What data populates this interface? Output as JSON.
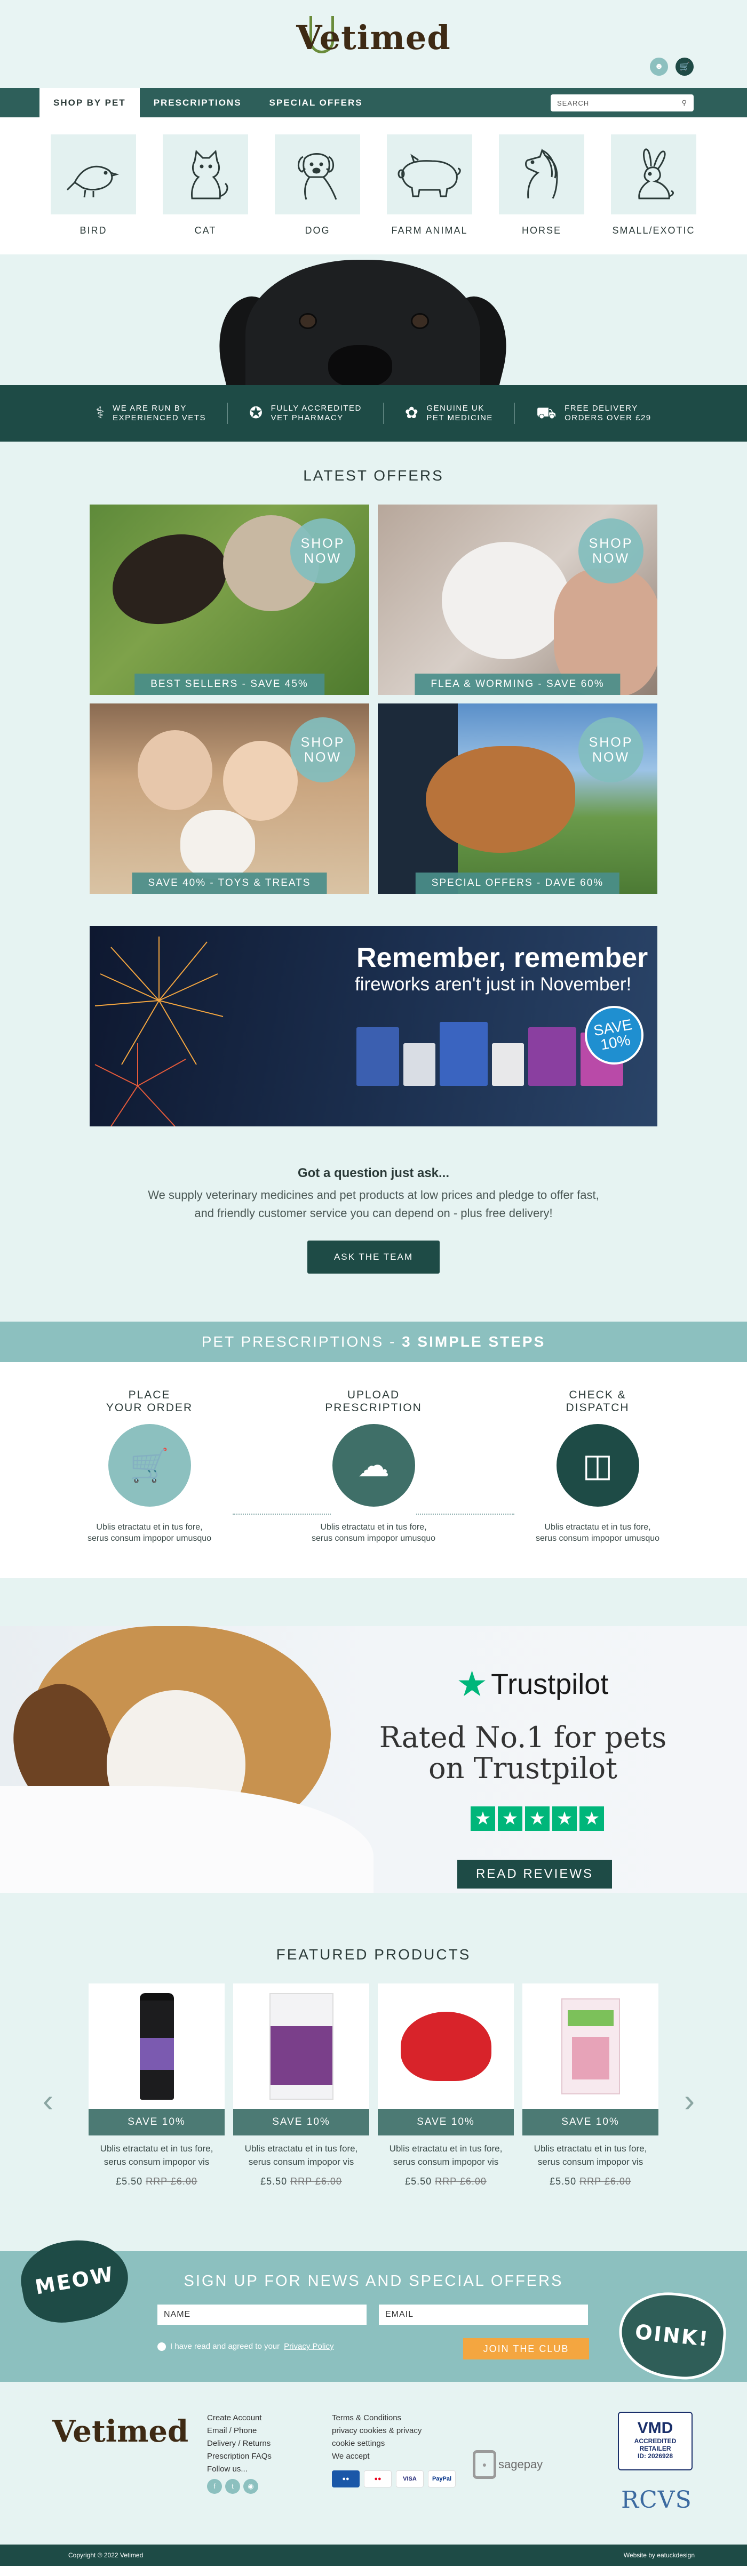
{
  "brand": {
    "logo_text": "Vetimed"
  },
  "header": {
    "icons": [
      "account-icon",
      "basket-icon"
    ]
  },
  "nav": {
    "tabs": [
      "SHOP BY PET",
      "PRESCRIPTIONS",
      "SPECIAL OFFERS"
    ],
    "search_placeholder": "SEARCH"
  },
  "pets": [
    {
      "label": "BIRD",
      "icon": "bird-icon"
    },
    {
      "label": "CAT",
      "icon": "cat-icon"
    },
    {
      "label": "DOG",
      "icon": "dog-icon"
    },
    {
      "label": "FARM ANIMAL",
      "icon": "pig-icon"
    },
    {
      "label": "HORSE",
      "icon": "horse-icon"
    },
    {
      "label": "SMALL/EXOTIC",
      "icon": "rabbit-icon"
    }
  ],
  "usp": [
    {
      "line1": "WE ARE RUN BY",
      "line2": "EXPERIENCED VETS",
      "icon": "vet-icon"
    },
    {
      "line1": "FULLY ACCREDITED",
      "line2": "VET PHARMACY",
      "icon": "badge-icon"
    },
    {
      "line1": "GENUINE UK",
      "line2": "PET MEDICINE",
      "icon": "paw-icon"
    },
    {
      "line1": "FREE DELIVERY",
      "line2": "ORDERS OVER £29",
      "icon": "truck-icon"
    }
  ],
  "offers": {
    "title": "LATEST OFFERS",
    "badge_line1": "SHOP",
    "badge_line2": "NOW",
    "items": [
      {
        "label": "BEST SELLERS - SAVE 45%"
      },
      {
        "label": "FLEA & WORMING - SAVE 60%"
      },
      {
        "label": "SAVE 40% - TOYS & TREATS"
      },
      {
        "label": "SPECIAL OFFERS - DAVE 60%"
      }
    ]
  },
  "fireworks": {
    "title": "Remember, remember",
    "subtitle": "fireworks aren't just in November!",
    "save_line1": "SAVE",
    "save_line2": "10%"
  },
  "question": {
    "title": "Got a question just ask...",
    "text_line1": "We supply veterinary medicines and pet products at low prices and pledge to offer fast,",
    "text_line2": "and friendly customer service you can depend on - plus free delivery!",
    "button": "ASK THE TEAM"
  },
  "prescriptions": {
    "title_start": "PET PRESCRIPTIONS - ",
    "title_bold": "3 SIMPLE STEPS",
    "steps": [
      {
        "line1": "PLACE",
        "line2": "YOUR ORDER",
        "text1": "Ublis etractatu et in tus fore,",
        "text2": "serus consum impopor umusquo",
        "icon": "cart-icon"
      },
      {
        "line1": "UPLOAD",
        "line2": "PRESCRIPTION",
        "text1": "Ublis etractatu et in tus fore,",
        "text2": "serus consum impopor umusquo",
        "icon": "cloud-upload-icon"
      },
      {
        "line1": "CHECK &",
        "line2": "DISPATCH",
        "text1": "Ublis etractatu et in tus fore,",
        "text2": "serus consum impopor umusquo",
        "icon": "box-search-icon"
      }
    ]
  },
  "trustpilot": {
    "logo": "Trustpilot",
    "heading_line1": "Rated No.1 for pets",
    "heading_line2": "on Trustpilot",
    "stars": 5,
    "button": "READ REVIEWS"
  },
  "featured": {
    "title": "FEATURED PRODUCTS",
    "products": [
      {
        "save": "SAVE 10%",
        "text1": "Ublis etractatu et in tus fore,",
        "text2": "serus consum impopor vis",
        "price": "£5.50",
        "rrp": "RRP £6.00"
      },
      {
        "save": "SAVE 10%",
        "text1": "Ublis etractatu et in tus fore,",
        "text2": "serus consum impopor vis",
        "price": "£5.50",
        "rrp": "RRP £6.00"
      },
      {
        "save": "SAVE 10%",
        "text1": "Ublis etractatu et in tus fore,",
        "text2": "serus consum impopor vis",
        "price": "£5.50",
        "rrp": "RRP £6.00"
      },
      {
        "save": "SAVE 10%",
        "text1": "Ublis etractatu et in tus fore,",
        "text2": "serus consum impopor vis",
        "price": "£5.50",
        "rrp": "RRP £6.00"
      }
    ]
  },
  "newsletter": {
    "title": "SIGN UP FOR NEWS AND SPECIAL OFFERS",
    "name_placeholder": "NAME",
    "email_placeholder": "EMAIL",
    "consent_text": "I have read and agreed to your",
    "consent_link": "Privacy Policy",
    "button": "JOIN THE CLUB",
    "bubble_left": "MEOW",
    "bubble_right": "OINK!"
  },
  "footer": {
    "col1": [
      "Create Account",
      "Email / Phone",
      "Delivery / Returns",
      "Prescription FAQs",
      "Follow us..."
    ],
    "col2": [
      "Terms & Conditions",
      "privacy cookies & privacy",
      "cookie settings",
      "We accept"
    ],
    "social": [
      "facebook-icon",
      "twitter-icon",
      "instagram-icon"
    ],
    "payments": [
      "maestro-icon",
      "mastercard-icon",
      "VISA",
      "PayPal"
    ],
    "sagepay": "sagepay",
    "vmd_title": "VMD",
    "vmd_line1": "ACCREDITED RETAILER",
    "vmd_line2": "ID: 2026928",
    "rcvs": "RCVS",
    "copyright": "Copyright © 2022 Vetimed",
    "credit": "Website by eatuckdesign"
  },
  "colors": {
    "dark_teal": "#1e4b46",
    "nav_teal": "#2e5f5a",
    "light_teal": "#8cc0bf",
    "pale_bg": "#e6f3f2",
    "orange": "#f4a640",
    "trustpilot_green": "#00b67a"
  }
}
